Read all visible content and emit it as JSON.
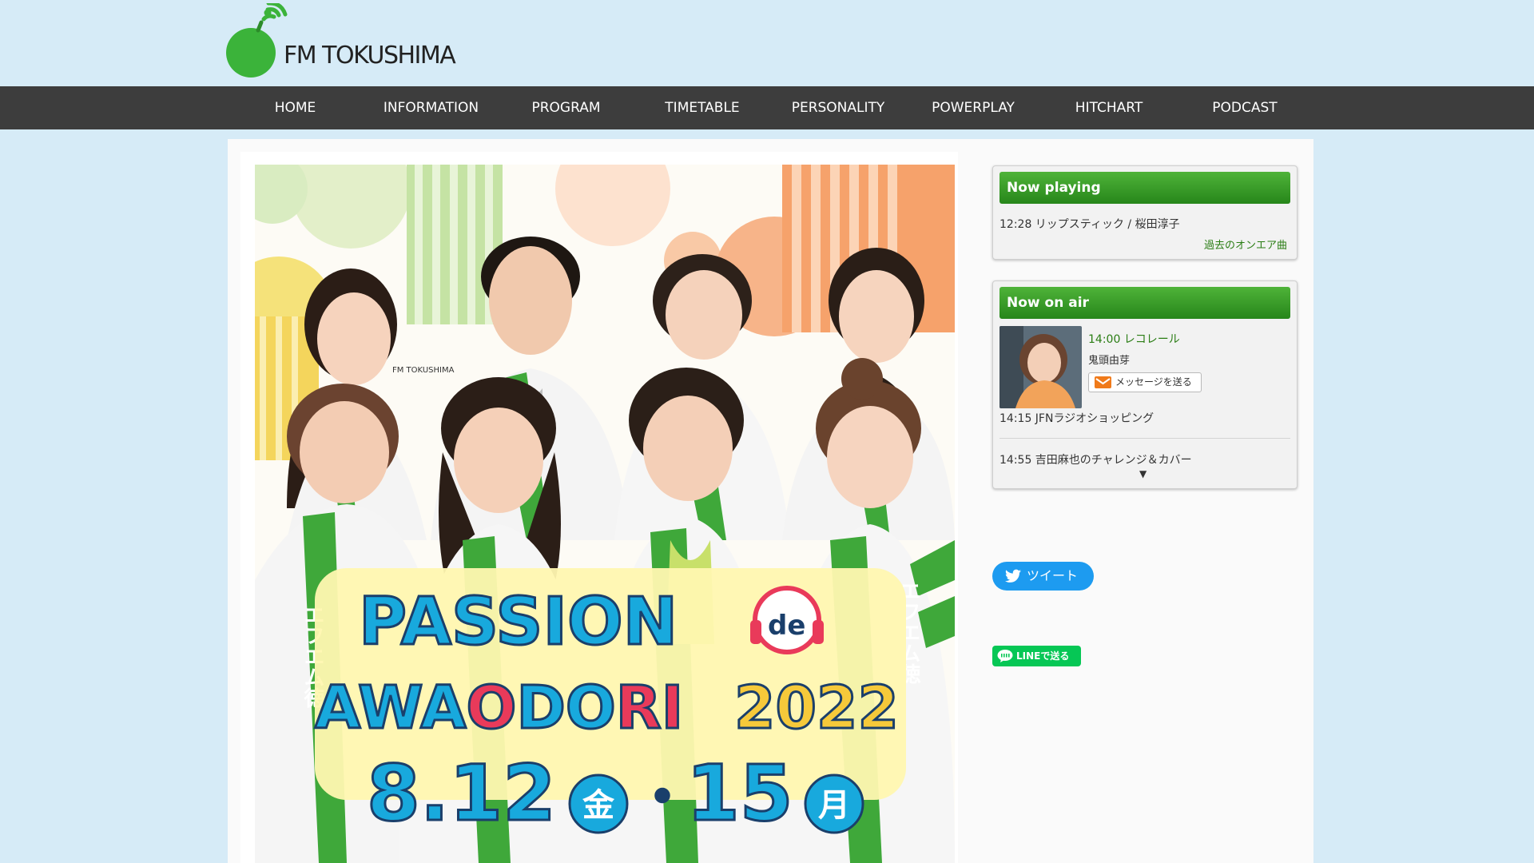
{
  "brand": {
    "name": "FM TOKUSHIMA",
    "color": "#3bb33a"
  },
  "nav": {
    "items": [
      {
        "label": "HOME"
      },
      {
        "label": "INFORMATION"
      },
      {
        "label": "PROGRAM"
      },
      {
        "label": "TIMETABLE"
      },
      {
        "label": "PERSONALITY"
      },
      {
        "label": "POWERPLAY"
      },
      {
        "label": "HITCHART"
      },
      {
        "label": "PODCAST"
      }
    ]
  },
  "poster": {
    "title_line1": "PASSION",
    "title_de": "de",
    "title_awa": "AWA",
    "title_o": "O",
    "title_do": "DO",
    "title_ri": "RI",
    "title_year": "2022",
    "date_start": "8.12",
    "day_start": "金",
    "separator": "・",
    "date_end": "15",
    "day_end": "月",
    "happi_text": "エフエム徳",
    "happi_logo": "FM TOKUSHIMA"
  },
  "now_playing": {
    "heading": "Now playing",
    "track": "12:28 リップスティック / 桜田淳子",
    "past_link": "過去のオンエア曲"
  },
  "now_on_air": {
    "heading": "Now on air",
    "current_time_title": "14:00 レコレール",
    "personality": "鬼頭由芽",
    "message_button": "メッセージを送る",
    "next_1": "14:15 JFNラジオショッピング",
    "next_2": "14:55 吉田麻也のチャレンジ＆カバー",
    "more": "▼"
  },
  "share": {
    "tweet": "ツイート",
    "line": "LINEで送る"
  },
  "colors": {
    "page_bg": "#d6ebf7",
    "nav_bg": "#3d3d3d",
    "sidebar_head": "#27861a",
    "tweet": "#1d9bf0",
    "line": "#06c755"
  }
}
